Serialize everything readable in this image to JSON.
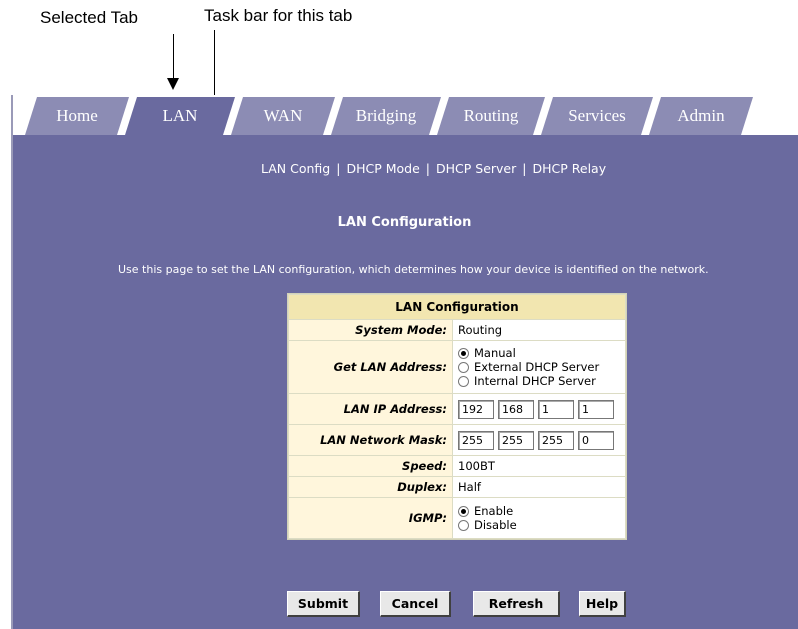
{
  "annotations": {
    "selected_tab": "Selected Tab",
    "task_bar": "Task bar for this tab"
  },
  "tabs": [
    {
      "label": "Home"
    },
    {
      "label": "LAN",
      "selected": true
    },
    {
      "label": "WAN"
    },
    {
      "label": "Bridging"
    },
    {
      "label": "Routing"
    },
    {
      "label": "Services"
    },
    {
      "label": "Admin"
    }
  ],
  "subnav": [
    "LAN Config",
    "DHCP Mode",
    "DHCP Server",
    "DHCP Relay"
  ],
  "page": {
    "title": "LAN Configuration",
    "intro": "Use this page to set the LAN configuration, which determines how your device is identified on the network."
  },
  "config": {
    "header": "LAN Configuration",
    "system_mode": {
      "label": "System Mode:",
      "value": "Routing"
    },
    "get_lan_address": {
      "label": "Get LAN Address:",
      "options": [
        "Manual",
        "External DHCP Server",
        "Internal DHCP Server"
      ],
      "selected": "Manual"
    },
    "lan_ip": {
      "label": "LAN IP Address:",
      "octets": [
        "192",
        "168",
        "1",
        "1"
      ]
    },
    "lan_mask": {
      "label": "LAN Network Mask:",
      "octets": [
        "255",
        "255",
        "255",
        "0"
      ]
    },
    "speed": {
      "label": "Speed:",
      "value": "100BT"
    },
    "duplex": {
      "label": "Duplex:",
      "value": "Half"
    },
    "igmp": {
      "label": "IGMP:",
      "options": [
        "Enable",
        "Disable"
      ],
      "selected": "Enable"
    }
  },
  "buttons": {
    "submit": "Submit",
    "cancel": "Cancel",
    "refresh": "Refresh",
    "help": "Help"
  },
  "colors": {
    "panel": "#6a6a9f",
    "tab": "#8c8cb4",
    "table_header": "#f2e6b0",
    "table_label": "#fff6dc"
  }
}
